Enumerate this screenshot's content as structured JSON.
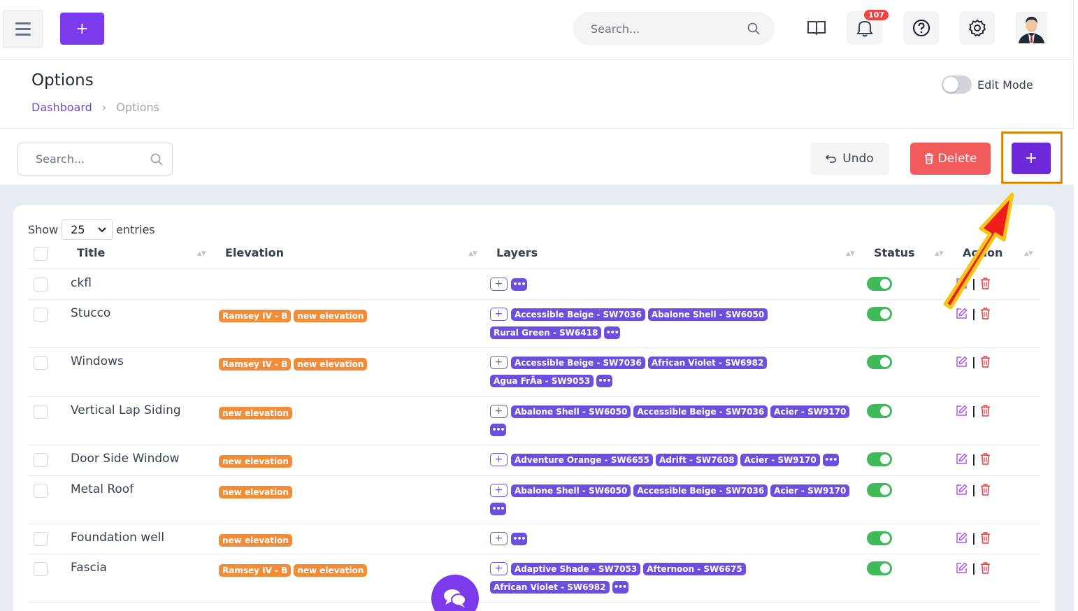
{
  "topbar": {
    "add_label": "+",
    "search_placeholder": "Search...",
    "notification_count": "107"
  },
  "header": {
    "title": "Options",
    "breadcrumb": {
      "home": "Dashboard",
      "separator": "›",
      "current": "Options"
    },
    "edit_mode_label": "Edit Mode"
  },
  "toolbar": {
    "search_placeholder": "Search...",
    "undo_label": "Undo",
    "delete_label": "Delete",
    "add_label": "+"
  },
  "table": {
    "show_label": "Show",
    "entries_value": "25",
    "entries_label": "entries",
    "columns": {
      "title": "Title",
      "elevation": "Elevation",
      "layers": "Layers",
      "status": "Status",
      "action": "Action"
    },
    "more_label": "•••",
    "rows": [
      {
        "title": "ckfl",
        "elevations": [],
        "layers": []
      },
      {
        "title": "Stucco",
        "elevations": [
          "Ramsey IV - B",
          "new elevation"
        ],
        "layers": [
          "Accessible Beige - SW7036",
          "Abalone Shell - SW6050",
          "Rural Green - SW6418"
        ]
      },
      {
        "title": "Windows",
        "elevations": [
          "Ramsey IV - B",
          "new elevation"
        ],
        "layers": [
          "Accessible Beige - SW7036",
          "African Violet - SW6982",
          "Agua FrÃ­a - SW9053"
        ]
      },
      {
        "title": "Vertical Lap Siding",
        "elevations": [
          "new elevation"
        ],
        "layers": [
          "Abalone Shell - SW6050",
          "Accessible Beige - SW7036",
          "Acier - SW9170"
        ]
      },
      {
        "title": "Door Side Window",
        "elevations": [
          "new elevation"
        ],
        "layers": [
          "Adventure Orange - SW6655",
          "Adrift - SW7608",
          "Acier - SW9170"
        ]
      },
      {
        "title": "Metal Roof",
        "elevations": [
          "new elevation"
        ],
        "layers": [
          "Abalone Shell - SW6050",
          "Accessible Beige - SW7036",
          "Acier - SW9170"
        ]
      },
      {
        "title": "Foundation well",
        "elevations": [
          "new elevation"
        ],
        "layers": []
      },
      {
        "title": "Fascia",
        "elevations": [
          "Ramsey IV - B",
          "new elevation"
        ],
        "layers": [
          "Adaptive Shade - SW7053",
          "Afternoon - SW6675",
          "African Violet - SW6982"
        ]
      }
    ]
  },
  "colors": {
    "accent": "#7c3aed",
    "danger": "#f15b5b",
    "success": "#3fb95a",
    "tag_orange": "#f28c38",
    "tag_purple": "#6d4fe0"
  }
}
